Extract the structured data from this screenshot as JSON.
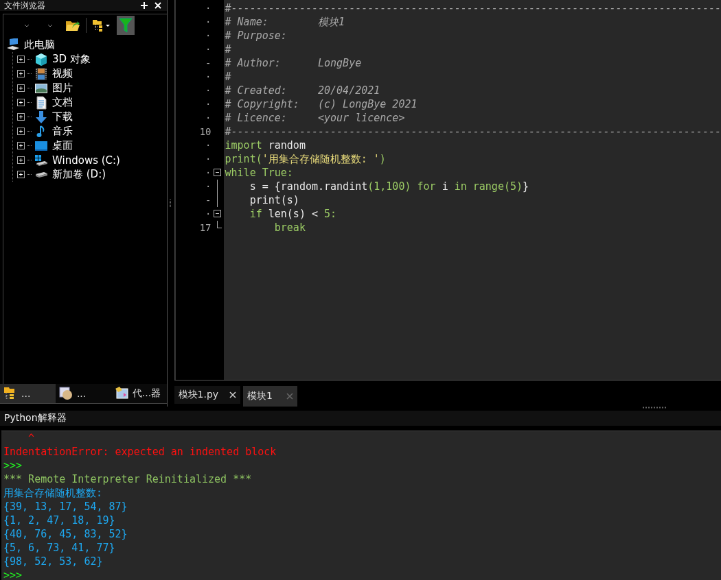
{
  "explorer": {
    "title": "文件浏览器",
    "toolbar": [
      {
        "kind": "combo"
      },
      {
        "kind": "combo"
      },
      {
        "kind": "open-folder"
      },
      {
        "kind": "tree-view"
      },
      {
        "kind": "filter",
        "on": true
      }
    ],
    "tree": [
      {
        "label": "此电脑",
        "kind": "computer",
        "children": [
          {
            "label": "3D 对象",
            "kind": "cube",
            "expanded": false
          },
          {
            "label": "视频",
            "kind": "film",
            "expanded": false
          },
          {
            "label": "图片",
            "kind": "image",
            "expanded": false
          },
          {
            "label": "文档",
            "kind": "document",
            "expanded": false
          },
          {
            "label": "下载",
            "kind": "download",
            "expanded": false
          },
          {
            "label": "音乐",
            "kind": "music",
            "expanded": false
          },
          {
            "label": "桌面",
            "kind": "desktop",
            "expanded": false
          },
          {
            "label": "Windows (C:)",
            "kind": "windows-drive",
            "expanded": false
          },
          {
            "label": "新加卷 (D:)",
            "kind": "drive",
            "expanded": false
          }
        ]
      }
    ],
    "tabs": [
      {
        "label": "...",
        "kind": "folder-tree",
        "selected": true
      },
      {
        "label": "...",
        "kind": "package",
        "selected": false
      },
      {
        "label": "代...器",
        "kind": "code-browser",
        "selected": false
      }
    ]
  },
  "editor": {
    "lines": [
      {
        "number": "·",
        "tokens": [
          {
            "text": "#-------------------------------------------------------------------------------",
            "kind": "comment"
          }
        ]
      },
      {
        "number": "·",
        "tokens": [
          {
            "text": "# Name:        模块1",
            "kind": "comment"
          }
        ]
      },
      {
        "number": "·",
        "tokens": [
          {
            "text": "# Purpose:",
            "kind": "comment"
          }
        ]
      },
      {
        "number": "·",
        "tokens": [
          {
            "text": "#",
            "kind": "comment"
          }
        ]
      },
      {
        "number": "-",
        "tokens": [
          {
            "text": "# Author:      LongBye",
            "kind": "comment"
          }
        ]
      },
      {
        "number": "·",
        "tokens": [
          {
            "text": "#",
            "kind": "comment"
          }
        ]
      },
      {
        "number": "·",
        "tokens": [
          {
            "text": "# Created:     20/04/2021",
            "kind": "comment"
          }
        ]
      },
      {
        "number": "·",
        "tokens": [
          {
            "text": "# Copyright:   (c) LongBye 2021",
            "kind": "comment"
          }
        ]
      },
      {
        "number": "·",
        "tokens": [
          {
            "text": "# Licence:     <your licence>",
            "kind": "comment"
          }
        ]
      },
      {
        "number": "10",
        "tokens": [
          {
            "text": "#-------------------------------------------------------------------------------",
            "kind": "comment"
          }
        ]
      },
      {
        "number": "·",
        "tokens": [
          {
            "text": "import",
            "kind": "keyword"
          },
          {
            "text": " random",
            "kind": "name"
          }
        ]
      },
      {
        "number": "·",
        "tokens": [
          {
            "text": "print(",
            "kind": "keyword"
          },
          {
            "text": "'用集合存储随机整数: '",
            "kind": "string"
          },
          {
            "text": ")",
            "kind": "keyword"
          }
        ]
      },
      {
        "number": "·",
        "expanded": true,
        "tokens": [
          {
            "text": "while True:",
            "kind": "keyword"
          }
        ]
      },
      {
        "number": "·",
        "tokens": [
          {
            "text": "    s = {random.randint",
            "kind": "name"
          },
          {
            "text": "(1,100) for ",
            "kind": "keyword"
          },
          {
            "text": "i",
            "kind": "name"
          },
          {
            "text": " in range(5)",
            "kind": "keyword"
          },
          {
            "text": "}",
            "kind": "name"
          }
        ]
      },
      {
        "number": "-",
        "tokens": [
          {
            "text": "    print(s)",
            "kind": "name"
          }
        ]
      },
      {
        "number": "·",
        "expanded": true,
        "tokens": [
          {
            "text": "    if ",
            "kind": "keyword"
          },
          {
            "text": "len(s) < ",
            "kind": "name"
          },
          {
            "text": "5:",
            "kind": "keyword"
          }
        ]
      },
      {
        "number": "17",
        "tokens": [
          {
            "text": "        break",
            "kind": "keyword"
          }
        ]
      }
    ],
    "tabs": [
      {
        "label": "模块1.py",
        "selected": false
      },
      {
        "label": "模块1",
        "selected": true
      }
    ]
  },
  "interpreter": {
    "title": "Python解释器",
    "lines": [
      {
        "text": "    ^",
        "kind": "error"
      },
      {
        "text": "IndentationError: expected an indented block",
        "kind": "error"
      },
      {
        "text": ">>>",
        "kind": "prompt"
      },
      {
        "text": "*** Remote Interpreter Reinitialized ***",
        "kind": "info"
      },
      {
        "text": "用集合存储随机整数:",
        "kind": "output"
      },
      {
        "text": "{39, 13, 17, 54, 87}",
        "kind": "output"
      },
      {
        "text": "{1, 2, 47, 18, 19}",
        "kind": "output"
      },
      {
        "text": "{40, 76, 45, 83, 52}",
        "kind": "output"
      },
      {
        "text": "{5, 6, 73, 41, 77}",
        "kind": "output"
      },
      {
        "text": "{98, 52, 53, 62}",
        "kind": "output"
      },
      {
        "text": ">>>",
        "kind": "prompt"
      }
    ]
  }
}
